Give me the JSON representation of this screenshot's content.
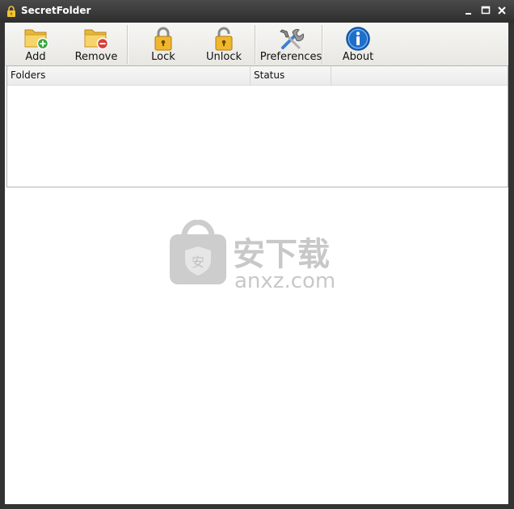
{
  "window": {
    "title": "SecretFolder"
  },
  "toolbar": {
    "buttons": [
      {
        "label": "Add",
        "icon": "folder-add-icon"
      },
      {
        "label": "Remove",
        "icon": "folder-remove-icon"
      },
      {
        "label": "Lock",
        "icon": "lock-closed-icon"
      },
      {
        "label": "Unlock",
        "icon": "lock-open-icon"
      },
      {
        "label": "Preferences",
        "icon": "tools-icon"
      },
      {
        "label": "About",
        "icon": "info-icon"
      }
    ]
  },
  "folder_list": {
    "columns": [
      "Folders",
      "Status",
      ""
    ],
    "rows": []
  },
  "watermark": {
    "text_cn": "安下载",
    "text_url": "anxz.com",
    "badge_char": "安"
  },
  "colors": {
    "titlebar": "#333333",
    "info_blue": "#1f6fc9",
    "folder_yellow": "#f2c94c",
    "add_green": "#3aa83a",
    "remove_red": "#d9413a",
    "watermark_gray": "#c8c8c8"
  }
}
